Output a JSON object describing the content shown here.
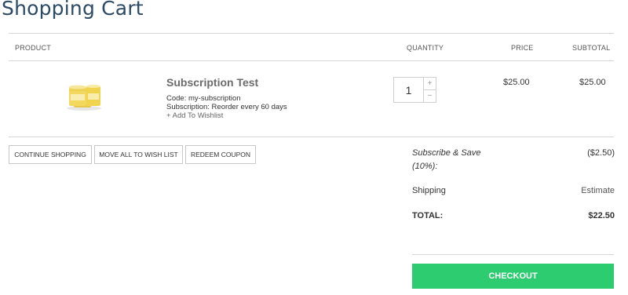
{
  "page": {
    "title": "Shopping Cart"
  },
  "table": {
    "headers": {
      "product": "PRODUCT",
      "quantity": "QUANTITY",
      "price": "PRICE",
      "subtotal": "SUBTOTAL"
    }
  },
  "item": {
    "name": "Subscription Test",
    "code": "Code: my-subscription",
    "subscription": "Subscription: Reorder every 60 days",
    "wishlist": "+ Add To Wishlist",
    "quantity": "1",
    "qty_up": "+",
    "qty_down": "−",
    "price": "$25.00",
    "subtotal": "$25.00",
    "image": "candle-jar-product-image"
  },
  "buttons": {
    "continue": "CONTINUE SHOPPING",
    "move_all": "MOVE ALL TO WISH LIST",
    "redeem": "REDEEM COUPON",
    "checkout": "CHECKOUT"
  },
  "summary": {
    "discount_label_1": "Subscribe & Save",
    "discount_label_2": "(10%):",
    "discount_value": "($2.50)",
    "shipping_label": "Shipping",
    "shipping_value": "Estimate",
    "total_label": "TOTAL:",
    "total_value": "$22.50"
  },
  "colors": {
    "title": "#2c4a66",
    "checkout": "#2ecc71",
    "divider": "#d6d6d6"
  }
}
